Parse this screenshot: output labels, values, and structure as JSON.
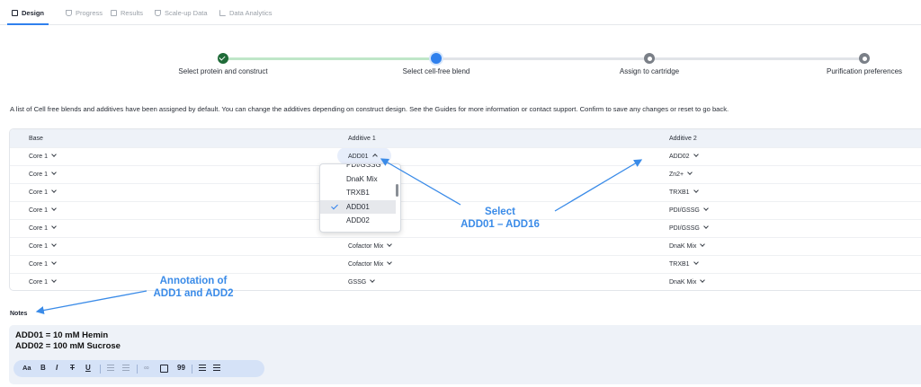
{
  "tabs": [
    {
      "label": "Design",
      "icon": "design-icon"
    },
    {
      "label": "Progress",
      "icon": "hourglass-icon"
    },
    {
      "label": "Results",
      "icon": "results-icon"
    },
    {
      "label": "Scale-up Data",
      "icon": "flask-icon"
    },
    {
      "label": "Data Analytics",
      "icon": "chart-icon"
    }
  ],
  "active_tab": "Design",
  "stepper": {
    "steps": [
      {
        "label": "Select protein and construct",
        "status": "done"
      },
      {
        "label": "Select cell-free blend",
        "status": "current"
      },
      {
        "label": "Assign to cartridge",
        "status": "todo"
      },
      {
        "label": "Purification preferences",
        "status": "todo"
      }
    ]
  },
  "description": "A list of Cell free blends and additives have been assigned by default. You can change the additives depending on construct design. See the Guides for more information or contact support. Confirm to save any changes or reset to go back.",
  "table": {
    "headers": {
      "base": "Base",
      "add1": "Additive 1",
      "add2": "Additive 2"
    },
    "rows": [
      {
        "base": "Core 1",
        "add1": "ADD01",
        "add2": "ADD02"
      },
      {
        "base": "Core 1",
        "add1": "",
        "add2": "Zn2+"
      },
      {
        "base": "Core 1",
        "add1": "",
        "add2": "TRXB1"
      },
      {
        "base": "Core 1",
        "add1": "",
        "add2": "PDI/GSSG"
      },
      {
        "base": "Core 1",
        "add1": "",
        "add2": "PDI/GSSG"
      },
      {
        "base": "Core 1",
        "add1": "Cofactor Mix",
        "add2": "DnaK Mix"
      },
      {
        "base": "Core 1",
        "add1": "Cofactor Mix",
        "add2": "TRXB1"
      },
      {
        "base": "Core 1",
        "add1": "GSSG",
        "add2": "DnaK Mix"
      }
    ]
  },
  "dropdown": {
    "options": [
      "PDI/GSSG",
      "DnaK Mix",
      "TRXB1",
      "ADD01",
      "ADD02"
    ],
    "selected": "ADD01"
  },
  "annotations": {
    "select_line1": "Select",
    "select_line2": "ADD01 – ADD16",
    "notes_line1": "Annotation of",
    "notes_line2": "ADD1 and ADD2",
    "color": "#3a8be8"
  },
  "notes": {
    "label": "Notes",
    "lines": [
      "ADD01 = 10 mM Hemin",
      "ADD02 = 100 mM Sucrose"
    ]
  },
  "toolbar": {
    "font_size_label": "Aa",
    "bold_label": "B",
    "italic_label": "I",
    "strike_label": "T",
    "underline_label": "U",
    "quote_label": "99"
  },
  "colors": {
    "accent": "#2f80ed",
    "done": "#1f6b38",
    "header_bg": "#eef2f8"
  }
}
